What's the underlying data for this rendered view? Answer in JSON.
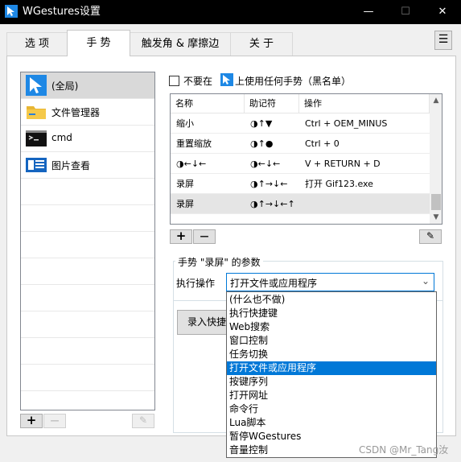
{
  "window": {
    "title": "WGestures设置",
    "minimize": "—",
    "maximize": "☐",
    "close": "✕"
  },
  "tabs": [
    {
      "label": "选 项"
    },
    {
      "label": "手 势"
    },
    {
      "label": "触发角 & 摩擦边"
    },
    {
      "label": "关 于"
    }
  ],
  "menu_icon": "☰",
  "apps": [
    {
      "label": "(全局)",
      "icon": "cursor-icon"
    },
    {
      "label": "文件管理器",
      "icon": "folder-icon"
    },
    {
      "label": "cmd",
      "icon": "console-icon"
    },
    {
      "label": "图片查看",
      "icon": "image-viewer-icon"
    }
  ],
  "app_list_buttons": {
    "add": "+",
    "remove": "—",
    "edit": "✎"
  },
  "blacklist": {
    "text_before": "不要在",
    "text_after": "上使用任何手势（黑名单）"
  },
  "gesture_table": {
    "headers": [
      "名称",
      "助记符",
      "操作"
    ],
    "rows": [
      {
        "name": "缩小",
        "mnemonic": "◑↑▼",
        "action": "Ctrl + OEM_MINUS"
      },
      {
        "name": "重置缩放",
        "mnemonic": "◑↑●",
        "action": "Ctrl + 0"
      },
      {
        "name": "◑←↓←",
        "mnemonic": "◑←↓←",
        "action": "V + RETURN + D"
      },
      {
        "name": "录屏",
        "mnemonic": "◑↑→↓←",
        "action": "打开 Gif123.exe"
      },
      {
        "name": "录屏",
        "mnemonic": "◑↑→↓←↑",
        "action": ""
      }
    ],
    "scroll_up": "▲",
    "scroll_down": "▼",
    "add": "+",
    "remove": "—",
    "edit": "✎"
  },
  "params": {
    "title": "手势 \"录屏\" 的参数",
    "action_label": "执行操作",
    "selected_action": "打开文件或应用程序",
    "chevron": "⌄",
    "record_button": "录入快捷键"
  },
  "dropdown_options": [
    "(什么也不做)",
    "执行快捷键",
    "Web搜索",
    "窗口控制",
    "任务切换",
    "打开文件或应用程序",
    "按键序列",
    "打开网址",
    "命令行",
    "Lua脚本",
    "暂停WGestures",
    "音量控制"
  ],
  "dropdown_selected_index": 5,
  "watermark": "CSDN @Mr_Tang汝",
  "colors": {
    "accent": "#0078d7",
    "titlebar": "#000000",
    "selected_row": "#d9d9d9"
  }
}
